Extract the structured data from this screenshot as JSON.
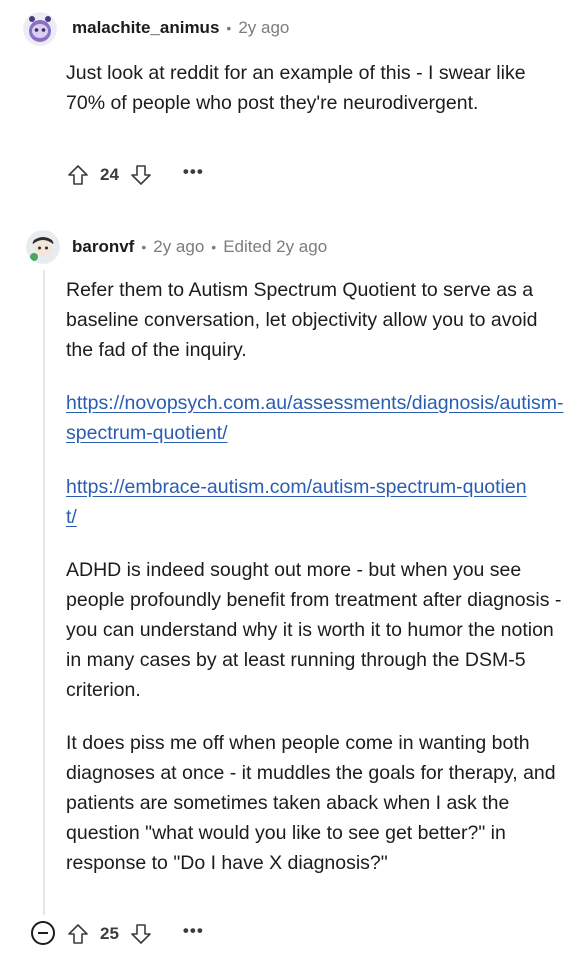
{
  "comments": [
    {
      "username": "malachite_animus",
      "time": "2y ago",
      "body": "Just look at reddit for an example of this - I swear like 70% of people who post they're neurodivergent.",
      "votes": "24",
      "avatar_icon": "snoo-avatar-purple"
    },
    {
      "username": "baronvf",
      "time": "2y ago",
      "edited": "Edited 2y ago",
      "paragraphs": [
        "Refer them to Autism Spectrum Quotient to serve as a baseline conversation, let objectivity allow you to avoid the fad of the inquiry.",
        "ADHD is indeed sought out more - but when you see people profoundly benefit from treatment after diagnosis - you can understand why it is worth it to humor the notion in many cases by at least running through the DSM-5 criterion.",
        "It does piss me off when people come in wanting both diagnoses at once - it muddles the goals for therapy, and patients are sometimes taken aback when I ask the question \"what would you like to see get better?\" in response to \"Do I have X diagnosis?\""
      ],
      "links": [
        "https://novopsych.com.au/assessments/diagnosis/autism-spectrum-quotient/",
        "https://embrace-autism.com/autism-spectrum-quotient/"
      ],
      "votes": "25",
      "avatar_icon": "snoo-avatar-dark"
    }
  ],
  "icons": {
    "upvote": "arrow-up-outline",
    "downvote": "arrow-down-outline",
    "more": "ellipsis",
    "more_label": "•••",
    "collapse": "minus-circle"
  },
  "colors": {
    "link": "#2a5db0",
    "meta": "#7c7c7c",
    "thread_line": "#e4e6e8"
  }
}
